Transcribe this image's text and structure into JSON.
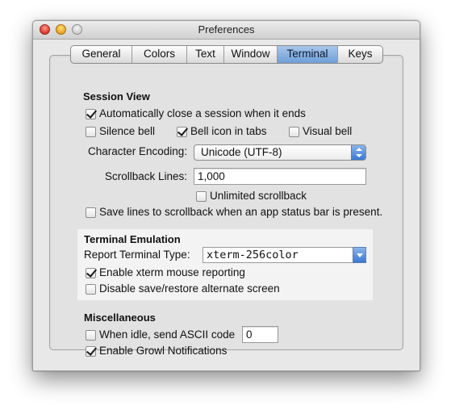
{
  "window": {
    "title": "Preferences"
  },
  "tabs": [
    "General",
    "Colors",
    "Text",
    "Window",
    "Terminal",
    "Keys"
  ],
  "active_tab": "Terminal",
  "session_view": {
    "heading": "Session View",
    "auto_close": {
      "label": "Automatically close a session when it ends",
      "checked": true
    },
    "silence_bell": {
      "label": "Silence bell",
      "checked": false
    },
    "bell_icon_in_tabs": {
      "label": "Bell icon in tabs",
      "checked": true
    },
    "visual_bell": {
      "label": "Visual bell",
      "checked": false
    },
    "encoding_label": "Character Encoding:",
    "encoding_value": "Unicode (UTF-8)",
    "scrollback_label": "Scrollback Lines:",
    "scrollback_value": "1,000",
    "unlimited_scrollback": {
      "label": "Unlimited scrollback",
      "checked": false
    },
    "save_lines": {
      "label": "Save lines to scrollback when an app status bar is present.",
      "checked": false
    }
  },
  "terminal_emulation": {
    "heading": "Terminal Emulation",
    "report_type_label": "Report Terminal Type:",
    "report_type_value": "xterm-256color",
    "mouse_reporting": {
      "label": "Enable xterm mouse reporting",
      "checked": true
    },
    "disable_alt_screen": {
      "label": "Disable save/restore alternate screen",
      "checked": false
    }
  },
  "miscellaneous": {
    "heading": "Miscellaneous",
    "idle_send": {
      "label": "When idle, send ASCII code",
      "checked": false
    },
    "idle_code_value": "0",
    "growl": {
      "label": "Enable Growl Notifications",
      "checked": true
    }
  },
  "colors": {
    "active_tab_top": "#a8c6ea",
    "active_tab_bottom": "#6f9fd7",
    "accent_blue": "#3a78d2"
  }
}
